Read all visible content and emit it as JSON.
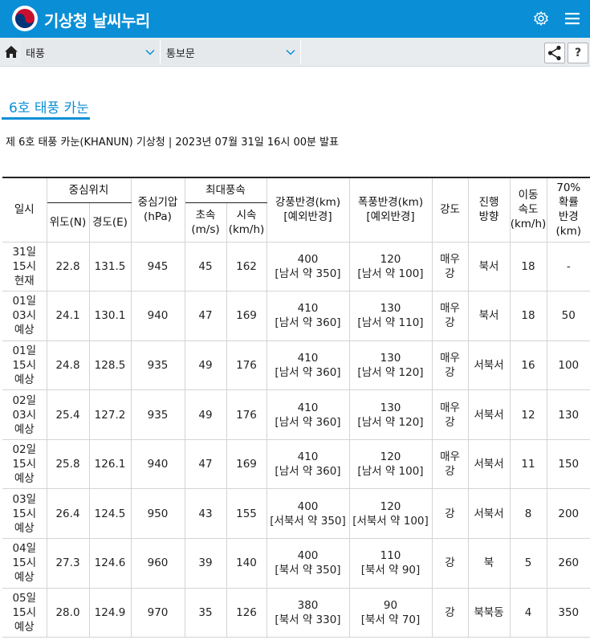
{
  "header": {
    "title": "기상청 날씨누리",
    "logo_icon": "kma-taegeuk-logo-icon",
    "settings_icon": "gear-icon",
    "menu_icon": "hamburger-menu-icon",
    "bg_color": "#0a8fd6"
  },
  "nav": {
    "home_icon": "home-icon",
    "category": "태풍",
    "subcategory": "통보문",
    "share_icon": "share-icon",
    "help_label": "?"
  },
  "page": {
    "title": "6호 태풍 카눈",
    "announcement": "제 6호 태풍 카눈(KHANUN) 기상청 | 2023년 07월 31일 16시 00분 발표",
    "accent_color": "#0a8fd6"
  },
  "table": {
    "headers": {
      "time": "일시",
      "center": "중심위치",
      "lat": "위도(N)",
      "lon": "경도(E)",
      "pressure_1": "중심기압",
      "pressure_2": "(hPa)",
      "maxwind": "최대풍속",
      "ms_1": "초속",
      "ms_2": "(m/s)",
      "kmh_1": "시속",
      "kmh_2": "(km/h)",
      "gale_1": "강풍반경(km)",
      "gale_2": "[예외반경]",
      "storm_1": "폭풍반경(km)",
      "storm_2": "[예외반경]",
      "intensity": "강도",
      "dir_1": "진행",
      "dir_2": "방향",
      "speed_1": "이동",
      "speed_2": "속도",
      "speed_3": "(km/h)",
      "prob_1": "70%",
      "prob_2": "확률",
      "prob_3": "반경",
      "prob_4": "(km)"
    },
    "rows": [
      {
        "day": "31일",
        "hour": "15시",
        "kind": "현재",
        "lat": "22.8",
        "lon": "131.5",
        "pressure": "945",
        "ms": "45",
        "kmh": "162",
        "gale": "400",
        "gale_ex": "[남서 약 350]",
        "storm": "120",
        "storm_ex": "[남서 약 100]",
        "int_1": "매우",
        "int_2": "강",
        "dir": "북서",
        "speed": "18",
        "prob": "-"
      },
      {
        "day": "01일",
        "hour": "03시",
        "kind": "예상",
        "lat": "24.1",
        "lon": "130.1",
        "pressure": "940",
        "ms": "47",
        "kmh": "169",
        "gale": "410",
        "gale_ex": "[남서 약 360]",
        "storm": "130",
        "storm_ex": "[남서 약 110]",
        "int_1": "매우",
        "int_2": "강",
        "dir": "북서",
        "speed": "18",
        "prob": "50"
      },
      {
        "day": "01일",
        "hour": "15시",
        "kind": "예상",
        "lat": "24.8",
        "lon": "128.5",
        "pressure": "935",
        "ms": "49",
        "kmh": "176",
        "gale": "410",
        "gale_ex": "[남서 약 360]",
        "storm": "130",
        "storm_ex": "[남서 약 120]",
        "int_1": "매우",
        "int_2": "강",
        "dir": "서북서",
        "speed": "16",
        "prob": "100"
      },
      {
        "day": "02일",
        "hour": "03시",
        "kind": "예상",
        "lat": "25.4",
        "lon": "127.2",
        "pressure": "935",
        "ms": "49",
        "kmh": "176",
        "gale": "410",
        "gale_ex": "[남서 약 360]",
        "storm": "130",
        "storm_ex": "[남서 약 120]",
        "int_1": "매우",
        "int_2": "강",
        "dir": "서북서",
        "speed": "12",
        "prob": "130"
      },
      {
        "day": "02일",
        "hour": "15시",
        "kind": "예상",
        "lat": "25.8",
        "lon": "126.1",
        "pressure": "940",
        "ms": "47",
        "kmh": "169",
        "gale": "410",
        "gale_ex": "[남서 약 360]",
        "storm": "120",
        "storm_ex": "[남서 약 100]",
        "int_1": "매우",
        "int_2": "강",
        "dir": "서북서",
        "speed": "11",
        "prob": "150"
      },
      {
        "day": "03일",
        "hour": "15시",
        "kind": "예상",
        "lat": "26.4",
        "lon": "124.5",
        "pressure": "950",
        "ms": "43",
        "kmh": "155",
        "gale": "400",
        "gale_ex": "[서북서 약 350]",
        "storm": "120",
        "storm_ex": "[서북서 약 100]",
        "int_1": "강",
        "int_2": "",
        "dir": "서북서",
        "speed": "8",
        "prob": "200"
      },
      {
        "day": "04일",
        "hour": "15시",
        "kind": "예상",
        "lat": "27.3",
        "lon": "124.6",
        "pressure": "960",
        "ms": "39",
        "kmh": "140",
        "gale": "400",
        "gale_ex": "[북서 약 350]",
        "storm": "110",
        "storm_ex": "[북서 약 90]",
        "int_1": "강",
        "int_2": "",
        "dir": "북",
        "speed": "5",
        "prob": "260"
      },
      {
        "day": "05일",
        "hour": "15시",
        "kind": "예상",
        "lat": "28.0",
        "lon": "124.9",
        "pressure": "970",
        "ms": "35",
        "kmh": "126",
        "gale": "380",
        "gale_ex": "[북서 약 330]",
        "storm": "90",
        "storm_ex": "[북서 약 70]",
        "int_1": "강",
        "int_2": "",
        "dir": "북북동",
        "speed": "4",
        "prob": "350"
      }
    ]
  }
}
